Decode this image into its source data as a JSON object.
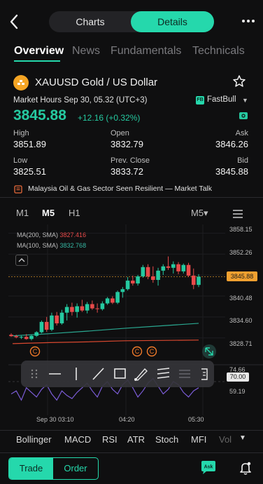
{
  "header": {
    "segments": {
      "charts": "Charts",
      "details": "Details"
    },
    "tabs": [
      "Overview",
      "News",
      "Fundamentals",
      "Technicals"
    ]
  },
  "instrument": {
    "title": "XAUUSD Gold / US Dollar",
    "market_hours": "Market Hours Sep 30, 05.32 (UTC+3)",
    "broker": "FastBull",
    "price": "3845.88",
    "change": "+12.16 (+0.32%)",
    "stats": {
      "high_label": "High",
      "high": "3851.89",
      "open_label": "Open",
      "open": "3832.79",
      "ask_label": "Ask",
      "ask": "3846.26",
      "low_label": "Low",
      "low": "3825.51",
      "prev_close_label": "Prev. Close",
      "prev_close": "3833.72",
      "bid_label": "Bid",
      "bid": "3845.88"
    }
  },
  "news_ticker": "Malaysia Oil & Gas Sector Seen Resilient — Market Talk",
  "timeframes": {
    "m1": "M1",
    "m5": "M5",
    "h1": "H1",
    "selected": "M5▾"
  },
  "chart": {
    "ma200_label": "MA(200, SMA)",
    "ma200_value": "3827.416",
    "ma100_label": "MA(100, SMA)",
    "ma100_value": "3832.768",
    "last_price": "3845.88",
    "rsi_value": "70.00",
    "rsi_ticks": [
      "74.66",
      "59.19"
    ],
    "x_ticks": [
      "Sep 30 03:10",
      "04:20",
      "05:30"
    ],
    "y_ticks": [
      "3858.15",
      "3852.26",
      "3840.48",
      "3834.60",
      "3828.71"
    ]
  },
  "chart_data": {
    "type": "candlestick",
    "ylim": [
      3825.5,
      3859.0
    ],
    "y_ticks": [
      3858.15,
      3852.26,
      3846.37,
      3840.48,
      3834.6,
      3828.71
    ],
    "candles": [
      {
        "o": 3829.6,
        "h": 3830.0,
        "l": 3829.0,
        "c": 3829.2
      },
      {
        "o": 3829.2,
        "h": 3829.6,
        "l": 3828.6,
        "c": 3828.9
      },
      {
        "o": 3828.9,
        "h": 3829.3,
        "l": 3828.4,
        "c": 3829.0
      },
      {
        "o": 3829.0,
        "h": 3829.8,
        "l": 3828.2,
        "c": 3828.4
      },
      {
        "o": 3828.4,
        "h": 3829.6,
        "l": 3828.0,
        "c": 3829.3
      },
      {
        "o": 3829.3,
        "h": 3830.6,
        "l": 3829.0,
        "c": 3830.3
      },
      {
        "o": 3830.3,
        "h": 3833.6,
        "l": 3830.0,
        "c": 3833.2
      },
      {
        "o": 3833.2,
        "h": 3834.6,
        "l": 3830.4,
        "c": 3831.0
      },
      {
        "o": 3831.0,
        "h": 3835.8,
        "l": 3830.6,
        "c": 3835.0
      },
      {
        "o": 3835.0,
        "h": 3836.0,
        "l": 3832.2,
        "c": 3832.8
      },
      {
        "o": 3832.8,
        "h": 3836.6,
        "l": 3832.4,
        "c": 3835.8
      },
      {
        "o": 3835.8,
        "h": 3838.2,
        "l": 3833.6,
        "c": 3837.4
      },
      {
        "o": 3837.4,
        "h": 3838.6,
        "l": 3835.0,
        "c": 3836.0
      },
      {
        "o": 3836.0,
        "h": 3838.4,
        "l": 3834.4,
        "c": 3837.6
      },
      {
        "o": 3837.6,
        "h": 3839.4,
        "l": 3836.0,
        "c": 3836.4
      },
      {
        "o": 3836.4,
        "h": 3838.8,
        "l": 3835.6,
        "c": 3838.2
      },
      {
        "o": 3838.2,
        "h": 3839.2,
        "l": 3836.6,
        "c": 3837.0
      },
      {
        "o": 3837.0,
        "h": 3838.4,
        "l": 3835.8,
        "c": 3836.8
      },
      {
        "o": 3836.8,
        "h": 3839.0,
        "l": 3836.4,
        "c": 3838.4
      },
      {
        "o": 3838.4,
        "h": 3840.2,
        "l": 3838.0,
        "c": 3839.8
      },
      {
        "o": 3839.8,
        "h": 3840.4,
        "l": 3838.2,
        "c": 3838.6
      },
      {
        "o": 3838.6,
        "h": 3842.0,
        "l": 3838.2,
        "c": 3841.6
      },
      {
        "o": 3841.6,
        "h": 3843.0,
        "l": 3840.0,
        "c": 3842.4
      },
      {
        "o": 3842.4,
        "h": 3845.8,
        "l": 3842.0,
        "c": 3844.8
      },
      {
        "o": 3844.8,
        "h": 3846.2,
        "l": 3843.4,
        "c": 3844.0
      },
      {
        "o": 3844.0,
        "h": 3846.4,
        "l": 3843.4,
        "c": 3846.0
      },
      {
        "o": 3846.0,
        "h": 3849.2,
        "l": 3845.6,
        "c": 3848.6
      },
      {
        "o": 3848.6,
        "h": 3849.4,
        "l": 3845.2,
        "c": 3846.0
      },
      {
        "o": 3846.0,
        "h": 3848.8,
        "l": 3844.2,
        "c": 3845.0
      },
      {
        "o": 3845.0,
        "h": 3848.4,
        "l": 3843.4,
        "c": 3847.6
      },
      {
        "o": 3847.6,
        "h": 3849.4,
        "l": 3846.4,
        "c": 3848.8
      },
      {
        "o": 3848.8,
        "h": 3851.6,
        "l": 3847.8,
        "c": 3848.4
      },
      {
        "o": 3848.4,
        "h": 3850.2,
        "l": 3846.8,
        "c": 3849.4
      },
      {
        "o": 3849.4,
        "h": 3850.0,
        "l": 3846.6,
        "c": 3847.4
      },
      {
        "o": 3847.4,
        "h": 3849.6,
        "l": 3846.8,
        "c": 3849.2
      },
      {
        "o": 3849.2,
        "h": 3849.8,
        "l": 3845.8,
        "c": 3846.2
      },
      {
        "o": 3846.2,
        "h": 3848.2,
        "l": 3842.4,
        "c": 3843.6
      },
      {
        "o": 3843.6,
        "h": 3846.6,
        "l": 3843.0,
        "c": 3845.9
      }
    ],
    "ma200": [
      3827.1,
      3827.4,
      3827.6,
      3827.9,
      3828.0,
      3828.1
    ],
    "ma100": [
      3829.3,
      3829.9,
      3830.6,
      3831.4,
      3832.1,
      3832.8
    ],
    "rsi": [
      62,
      64,
      58,
      66,
      63,
      60,
      65,
      68,
      62,
      58,
      64,
      61,
      59,
      63,
      66,
      69,
      64,
      60,
      67,
      70,
      65,
      62,
      68,
      71,
      66,
      60,
      64,
      69,
      72,
      67,
      62,
      65,
      70,
      68,
      63,
      60,
      64,
      66
    ],
    "x_ticks": [
      "Sep 30 03:10",
      "04:20",
      "05:30"
    ]
  },
  "indicators": [
    "Bollinger",
    "MACD",
    "RSI",
    "ATR",
    "Stoch",
    "MFI",
    "Vol"
  ],
  "bottom": {
    "trade": "Trade",
    "order": "Order",
    "ask": "Ask"
  },
  "colors": {
    "accent": "#25d8ac",
    "up": "#25c9a0",
    "down": "#e84a4a",
    "price_tag": "#f0a030"
  }
}
